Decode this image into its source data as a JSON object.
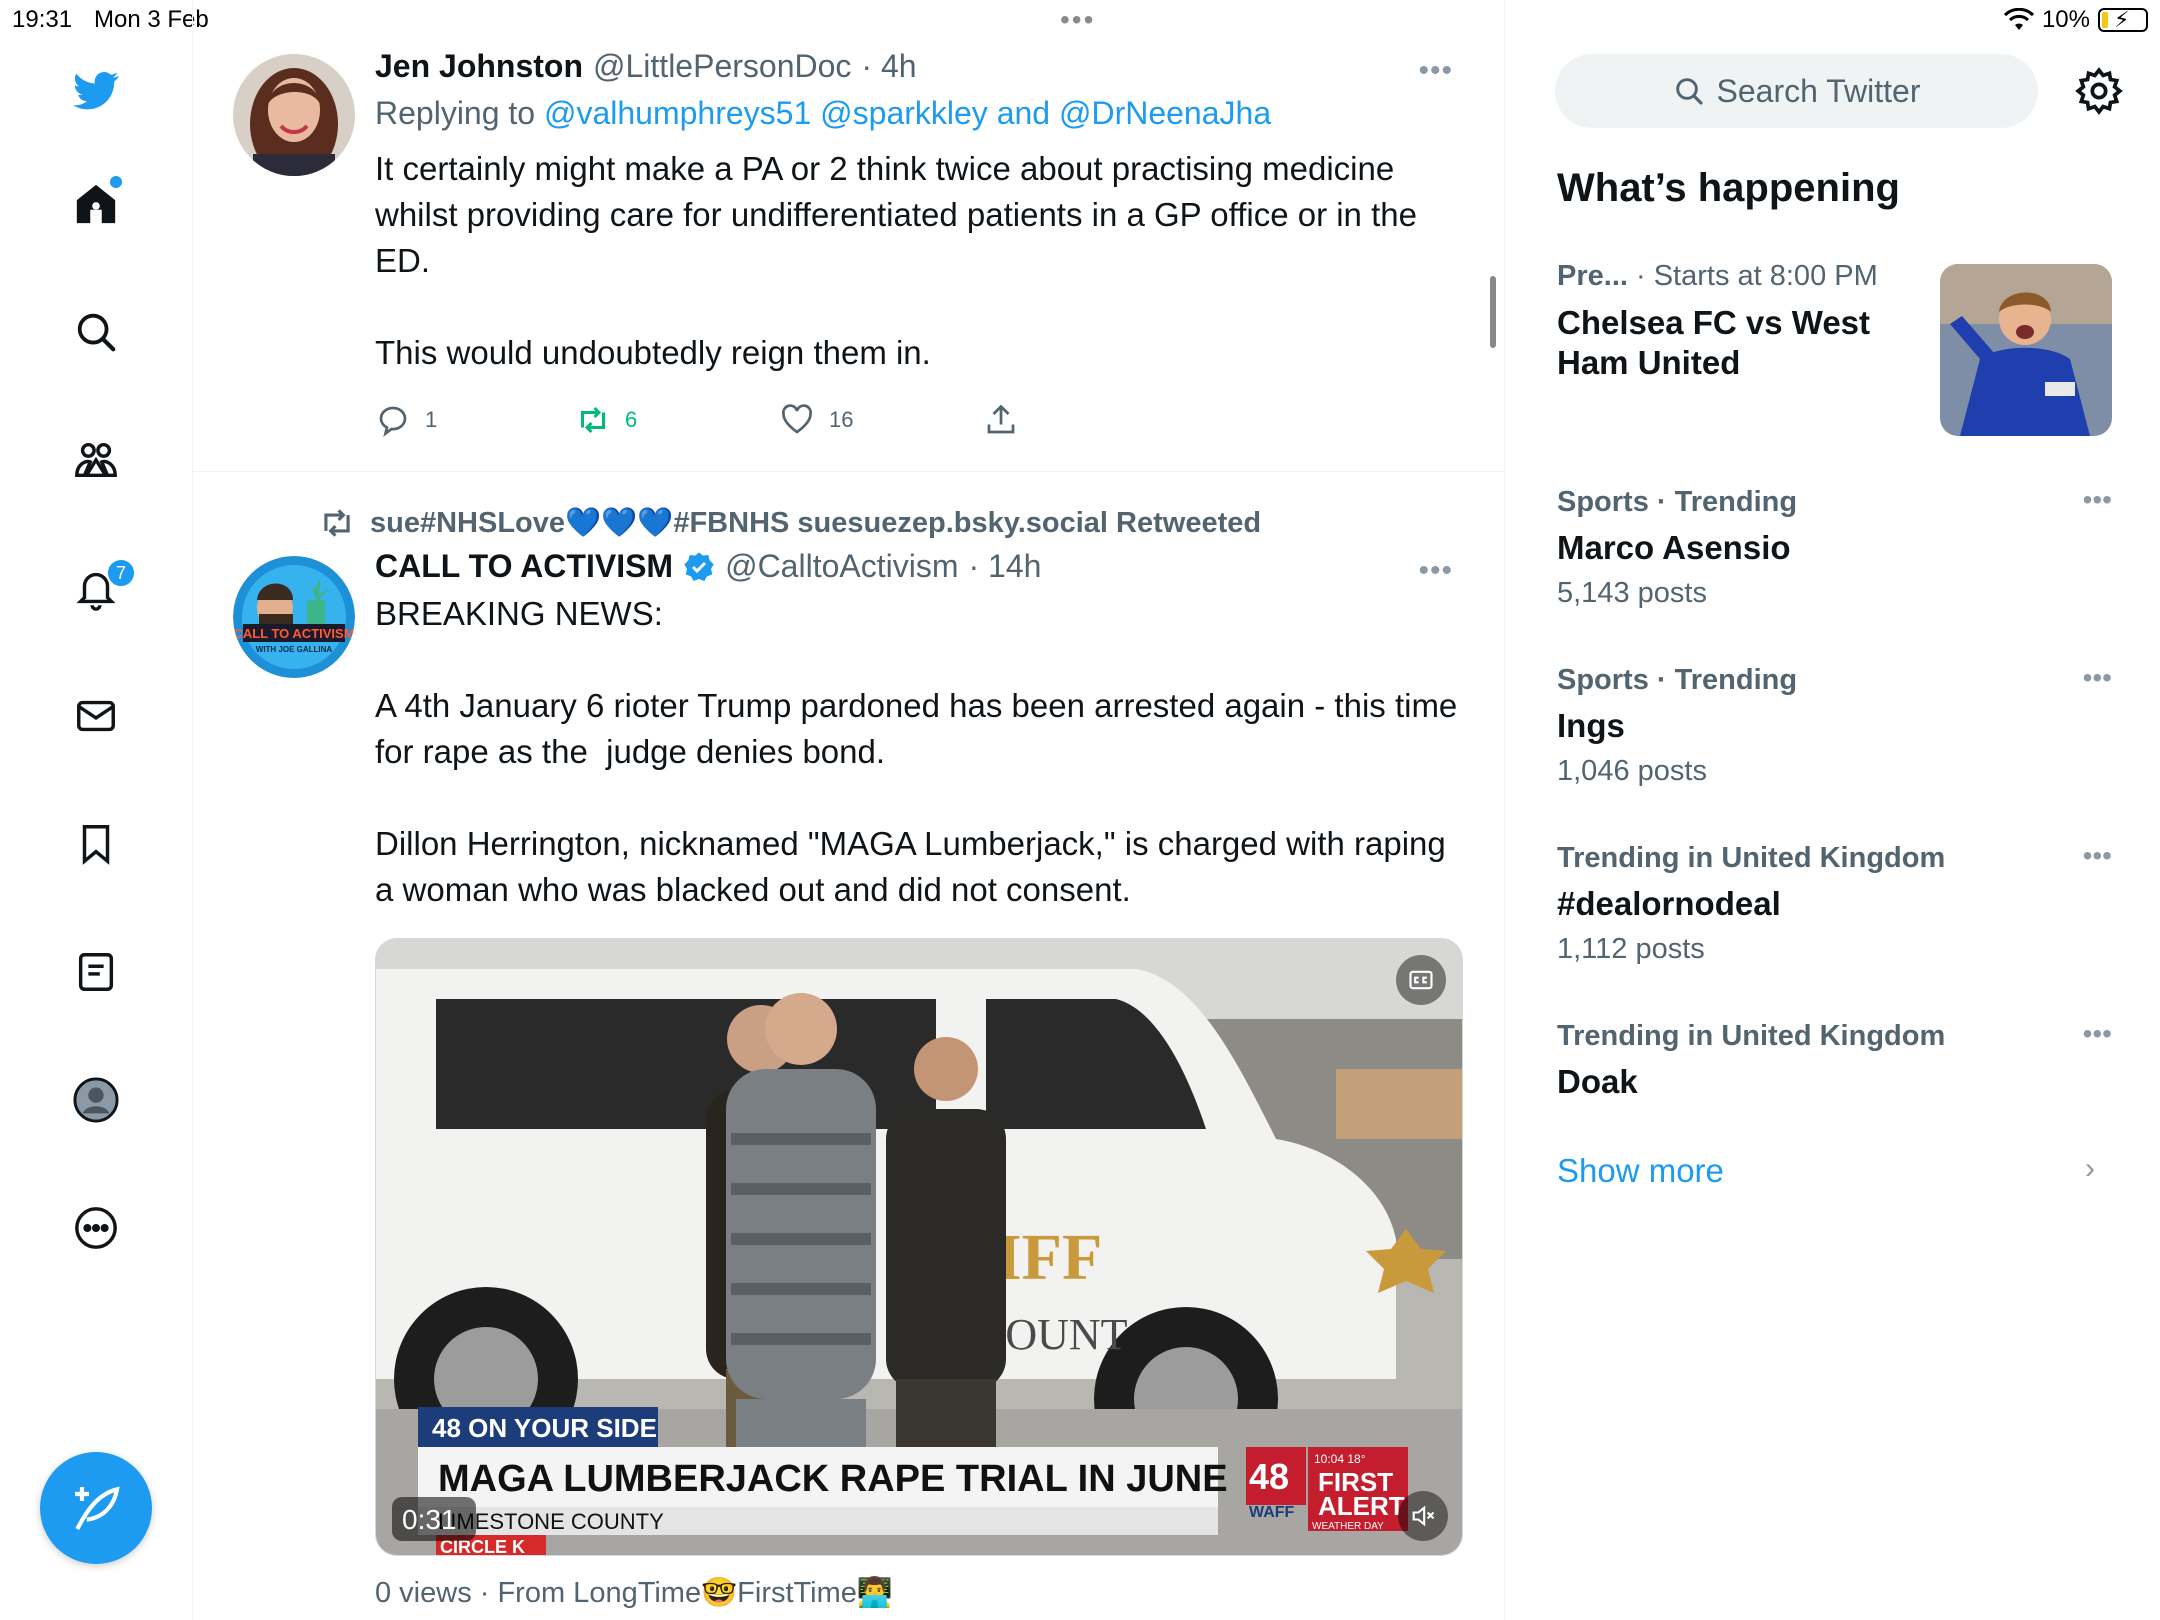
{
  "status": {
    "time": "19:31",
    "date": "Mon 3 Feb",
    "battery": "10%",
    "battery_level": 0.1
  },
  "nav": {
    "items": [
      {
        "name": "twitter-logo-icon"
      },
      {
        "name": "home-icon",
        "has_dot": true
      },
      {
        "name": "search-icon"
      },
      {
        "name": "communities-icon"
      },
      {
        "name": "notifications-icon",
        "badge": "7"
      },
      {
        "name": "messages-icon"
      },
      {
        "name": "bookmarks-icon"
      },
      {
        "name": "lists-icon"
      },
      {
        "name": "profile-icon"
      },
      {
        "name": "more-icon"
      }
    ],
    "compose_icon": "compose-feather-icon"
  },
  "colors": {
    "accent": "#1d9bf0",
    "retweet_green": "#00ba7c",
    "muted": "#536471"
  },
  "tweets": [
    {
      "name": "Jen Johnston",
      "handle": "@LittlePersonDoc",
      "time": "· 4h",
      "replying_prefix": "Replying to",
      "replying_to": "@valhumphreys51 @sparkkley and @DrNeenaJha",
      "text": "It certainly might make a PA or 2 think twice about practising medicine whilst providing care for undifferentiated patients in a GP office or in the ED.\n\nThis would undoubtedly reign them in.",
      "replies": "1",
      "retweets": "6",
      "likes": "16"
    },
    {
      "retweeted_by": "sue#NHSLove💙💙💙#FBNHS suesuezep.bsky.social Retweeted",
      "name": "CALL TO ACTIVISM",
      "handle": "@CalltoActivism",
      "time": "· 14h",
      "text": "BREAKING NEWS:\n\nA 4th January 6 rioter Trump pardoned has been arrested again - this time for rape as the  judge denies bond.\n\nDillon Herrington, nicknamed \"MAGA Lumberjack,\" is charged with raping a woman who was blacked out and did not consent.",
      "video": {
        "chyron_small": "48 ON YOUR SIDE",
        "chyron_main": "MAGA LUMBERJACK RAPE TRIAL IN JUNE",
        "chyron_sub": "LIMESTONE COUNTY",
        "duration": "0:31",
        "van_text_1": "IFF",
        "van_text_2": "COUNT",
        "station_num": "48",
        "station_name": "WAFF",
        "alert_1": "FIRST",
        "alert_2": "ALERT",
        "alert_time": "10:04  18°",
        "alert_sub": "WEATHER DAY",
        "sponsor": "CIRCLE K",
        "avatar_text_1": "CALL TO ACTIVISM",
        "avatar_text_2": "WITH JOE GALLINA"
      },
      "views": "0 views · From LongTime🤓FirstTime👨‍💻"
    }
  ],
  "sidebar": {
    "search_placeholder": "Search Twitter",
    "whats_happening": "What’s happening",
    "event": {
      "meta_bold": "Pre...",
      "meta": " · Starts at 8:00 PM",
      "title": "Chelsea FC vs West Ham United"
    },
    "trends": [
      {
        "meta": "Sports · Trending",
        "name": "Marco Asensio",
        "count": "5,143 posts"
      },
      {
        "meta": "Sports · Trending",
        "name": "Ings",
        "count": "1,046 posts"
      },
      {
        "meta": "Trending in United Kingdom",
        "name": "#dealornodeal",
        "count": "1,112 posts"
      },
      {
        "meta": "Trending in United Kingdom",
        "name": "Doak",
        "count": ""
      }
    ],
    "show_more": "Show more"
  }
}
